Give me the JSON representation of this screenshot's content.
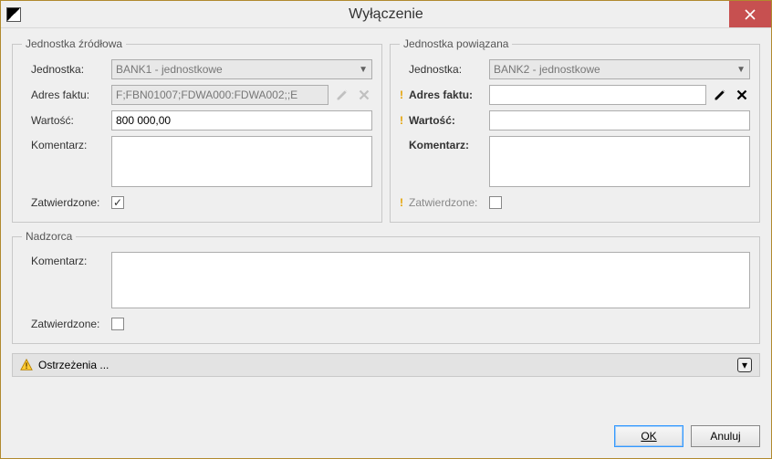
{
  "window": {
    "title": "Wyłączenie"
  },
  "source": {
    "legend": "Jednostka źródłowa",
    "unit_label": "Jednostka:",
    "unit_value": "BANK1 - jednostkowe",
    "fact_label": "Adres faktu:",
    "fact_value": "F;FBN01007;FDWA000:FDWA002;;E",
    "value_label": "Wartość:",
    "value_value": "800 000,00",
    "comment_label": "Komentarz:",
    "comment_value": "",
    "approved_label": "Zatwierdzone:",
    "approved_checked": "✓"
  },
  "linked": {
    "legend": "Jednostka powiązana",
    "unit_label": "Jednostka:",
    "unit_value": "BANK2 - jednostkowe",
    "fact_label": "Adres faktu:",
    "fact_value": "",
    "value_label": "Wartość:",
    "value_value": "",
    "comment_label": "Komentarz:",
    "comment_value": "",
    "approved_label": "Zatwierdzone:"
  },
  "supervisor": {
    "legend": "Nadzorca",
    "comment_label": "Komentarz:",
    "comment_value": "",
    "approved_label": "Zatwierdzone:"
  },
  "warnings": {
    "text": "Ostrzeżenia ..."
  },
  "footer": {
    "ok": "OK",
    "cancel": "Anuluj"
  }
}
